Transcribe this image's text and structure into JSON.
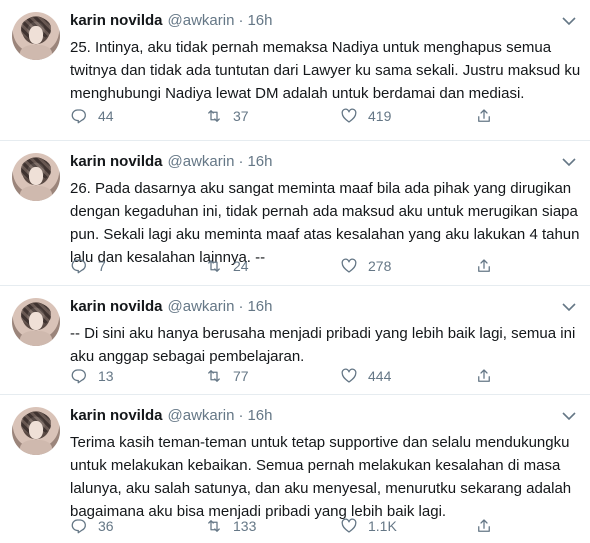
{
  "tweets": [
    {
      "name": "karin novilda",
      "handle": "@awkarin",
      "dot": "·",
      "time": "16h",
      "lines": [
        "25. Intinya, aku tidak pernah memaksa Nadiya untuk menghapus semua",
        "twitnya dan tidak ada tuntutan dari Lawyer ku sama sekali. Justru maksud ku",
        "menghubungi Nadiya lewat DM adalah untuk berdamai dan mediasi."
      ],
      "replies": "44",
      "retweets": "37",
      "likes": "419"
    },
    {
      "name": "karin novilda",
      "handle": "@awkarin",
      "dot": "·",
      "time": "16h",
      "lines": [
        "26. Pada dasarnya aku sangat meminta maaf bila ada pihak yang dirugikan",
        "dengan kegaduhan ini, tidak pernah ada maksud aku untuk merugikan siapa",
        "pun. Sekali lagi aku meminta maaf atas kesalahan yang aku lakukan 4 tahun",
        "lalu dan kesalahan lainnya. --"
      ],
      "replies": "7",
      "retweets": "24",
      "likes": "278"
    },
    {
      "name": "karin novilda",
      "handle": "@awkarin",
      "dot": "·",
      "time": "16h",
      "lines": [
        "-- Di sini aku hanya berusaha menjadi pribadi yang lebih baik lagi, semua ini",
        "aku anggap sebagai pembelajaran."
      ],
      "replies": "13",
      "retweets": "77",
      "likes": "444"
    },
    {
      "name": "karin novilda",
      "handle": "@awkarin",
      "dot": "·",
      "time": "16h",
      "lines": [
        "Terima kasih teman-teman untuk tetap supportive dan selalu mendukungku",
        "untuk melakukan kebaikan. Semua pernah melakukan kesalahan di masa",
        "lalunya, aku salah satunya, dan aku menyesal, menurutku sekarang adalah",
        "bagaimana aku bisa menjadi pribadi yang lebih baik lagi."
      ],
      "replies": "36",
      "retweets": "133",
      "likes": "1.1K"
    }
  ],
  "icons": {
    "reply": "reply-icon",
    "retweet": "retweet-icon",
    "like": "heart-icon",
    "share": "share-icon",
    "menu": "chevron-down-icon"
  },
  "colors": {
    "text": "#14171a",
    "secondary": "#657786",
    "divider": "#e6ecf0"
  }
}
